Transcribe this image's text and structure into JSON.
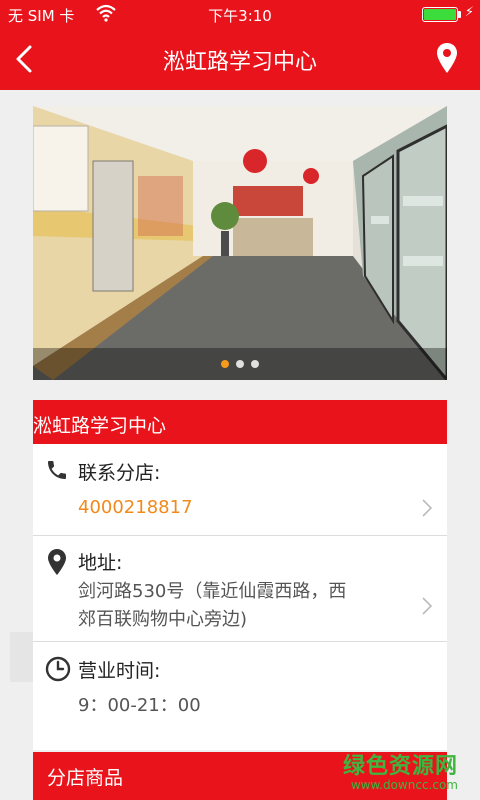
{
  "status_bar": {
    "carrier": "无 SIM 卡",
    "time": "下午3:10",
    "battery_level": 1.0
  },
  "nav": {
    "title": "淞虹路学习中心",
    "back_icon": "chevron-left-icon",
    "map_icon": "map-pin-icon"
  },
  "carousel": {
    "slide_count": 3,
    "active_index": 0
  },
  "store": {
    "name": "淞虹路学习中心",
    "phone_label": "联系分店:",
    "phone": "4000218817",
    "address_label": "地址:",
    "address_line1": "剑河路530号（靠近仙霞西路，西",
    "address_line2": "郊百联购物中心旁边)",
    "hours_label": "营业时间:",
    "hours": "9：00-21：00"
  },
  "products": {
    "title": "分店商品"
  },
  "watermark": {
    "main": "绿色资源网",
    "sub": "www.downcc.com"
  },
  "colors": {
    "brand_red": "#e8131b",
    "phone_orange": "#f08a1c",
    "dot_active": "#f49a1c"
  }
}
